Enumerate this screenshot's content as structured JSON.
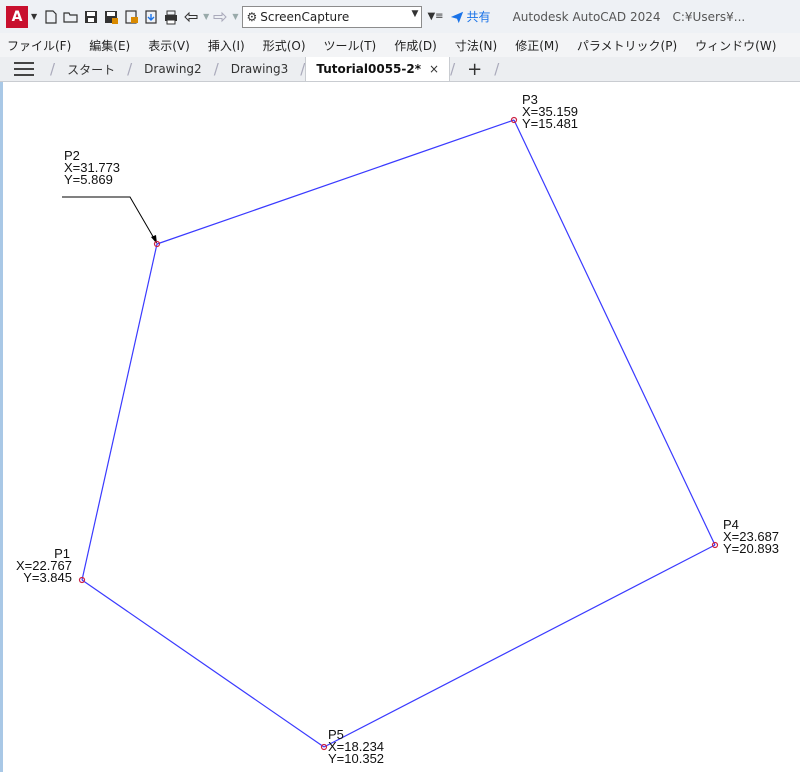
{
  "titlebar": {
    "logo": "A",
    "quick_access_icons": [
      "new-file-icon",
      "open-folder-icon",
      "save-icon",
      "save-as-icon",
      "open-from-web-icon",
      "save-to-web-icon",
      "plot-icon",
      "undo-icon",
      "redo-icon"
    ],
    "workspace_value": "ScreenCapture",
    "share_label": "共有",
    "app_title": "Autodesk AutoCAD 2024",
    "path": "C:¥Users¥..."
  },
  "menu": {
    "items": [
      "ファイル(F)",
      "編集(E)",
      "表示(V)",
      "挿入(I)",
      "形式(O)",
      "ツール(T)",
      "作成(D)",
      "寸法(N)",
      "修正(M)",
      "パラメトリック(P)",
      "ウィンドウ(W)"
    ]
  },
  "tabs": {
    "items": [
      "スタート",
      "Drawing2",
      "Drawing3"
    ],
    "active": "Tutorial0055-2*",
    "close": "×",
    "add": "+"
  },
  "drawing": {
    "line_color": "#3a3aff",
    "point_color": "#cc2244",
    "leader_color": "#000000",
    "points": [
      {
        "name": "P1",
        "x_text": "X=22.767",
        "y_text": "Y=3.845"
      },
      {
        "name": "P2",
        "x_text": "X=31.773",
        "y_text": "Y=5.869"
      },
      {
        "name": "P3",
        "x_text": "X=35.159",
        "y_text": "Y=15.481"
      },
      {
        "name": "P4",
        "x_text": "X=23.687",
        "y_text": "Y=20.893"
      },
      {
        "name": "P5",
        "x_text": "X=18.234",
        "y_text": "Y=10.352"
      }
    ]
  }
}
